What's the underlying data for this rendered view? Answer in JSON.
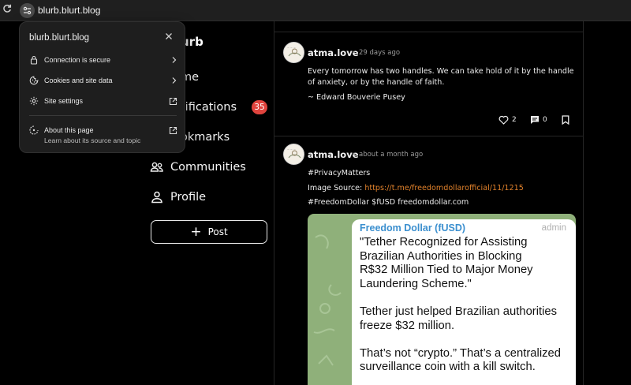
{
  "browser": {
    "url": "blurb.blurt.blog"
  },
  "site_popup": {
    "title": "blurb.blurt.blog",
    "rows": [
      {
        "label": "Connection is secure"
      },
      {
        "label": "Cookies and site data"
      },
      {
        "label": "Site settings"
      }
    ],
    "about": {
      "label": "About this page",
      "sub": "Learn about its source and topic"
    }
  },
  "sidebar": {
    "logo_fragment": "urb",
    "items": [
      {
        "label": "me"
      },
      {
        "label": "tifications"
      },
      {
        "label": "okmarks"
      },
      {
        "label": "Communities"
      },
      {
        "label": "Profile"
      }
    ],
    "notifications_count": "35",
    "post_label": "Post"
  },
  "feed": {
    "posts": [
      {
        "author": "atma.love",
        "time": "29 days ago",
        "lines": [
          "Every tomorrow has two handles. We can take hold of it by the handle",
          "of anxiety, or by the handle of faith.",
          "~ Edward Bouverie Pusey"
        ],
        "likes": "2",
        "comments": "0"
      },
      {
        "author": "atma.love",
        "time": "about a month ago",
        "hashtag": "#PrivacyMatters",
        "image_source_label": "Image Source: ",
        "image_source_link": "https://t.me/freedomdollarofficial/11/1215",
        "footer_line": "#FreedomDollar $fUSD freedomdollar.com",
        "embed": {
          "channel": "Freedom Dollar (fUSD)",
          "badge": "admin",
          "p1_lines": [
            "\"Tether Recognized for Assisting",
            "Brazilian Authorities in Blocking",
            "R$32 Million Tied to Major Money",
            "Laundering Scheme.\""
          ],
          "p2_lines": [
            "Tether just helped Brazilian authorities",
            "freeze $32 million."
          ],
          "p3_lines": [
            "That’s not “crypto.” That’s a centralized",
            "surveillance coin with a kill switch."
          ]
        }
      }
    ]
  },
  "colors": {
    "badge": "#e0443e",
    "link": "#e0812b",
    "tg_name": "#3b8fcf"
  }
}
